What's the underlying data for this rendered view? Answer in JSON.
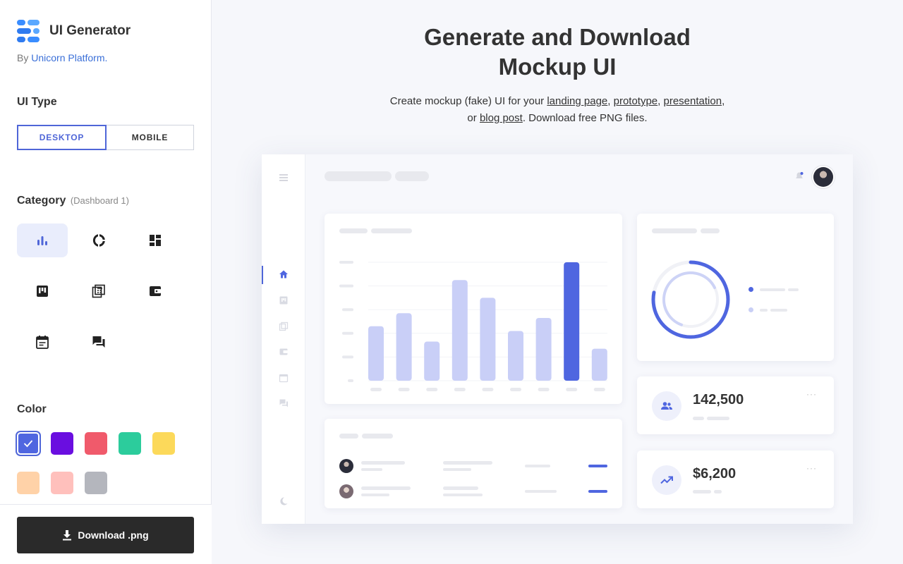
{
  "sidebar": {
    "app_title": "UI Generator",
    "byline_prefix": "By",
    "byline_link": "Unicorn Platform.",
    "ui_type": {
      "title": "UI Type",
      "options": [
        "DESKTOP",
        "MOBILE"
      ],
      "selected": "DESKTOP"
    },
    "category": {
      "title": "Category",
      "selected_label": "(Dashboard 1)",
      "icons": [
        "bar-chart-icon",
        "donut-chart-icon",
        "dashboard-grid-icon",
        "kanban-board-icon",
        "calculator-icon",
        "wallet-icon",
        "calendar-icon",
        "chat-bubbles-icon"
      ],
      "selected_index": 0
    },
    "color": {
      "title": "Color",
      "swatches": [
        "#4f66e0",
        "#6a0ee0",
        "#f05a6b",
        "#2ccc9c",
        "#fcd95a",
        "#ffd2a8",
        "#ffc0bc",
        "#b4b6bd"
      ],
      "selected_index": 0
    },
    "download_label": "Download .png"
  },
  "main": {
    "headline_line1": "Generate and Download",
    "headline_line2": "Mockup UI",
    "lede": {
      "t1": "Create mockup (fake) UI for your ",
      "l1": "landing page",
      "t2": ", ",
      "l2": "prototype",
      "t3": ", ",
      "l3": "presentation",
      "t4": ",",
      "t5": "or ",
      "l4": "blog post",
      "t6": ". Download free PNG files."
    }
  },
  "mockup": {
    "accent": "#4f66e0",
    "kpis": [
      {
        "value": "142,500",
        "icon": "users-icon"
      },
      {
        "value": "$6,200",
        "icon": "trend-up-icon"
      }
    ],
    "bar_chart": {
      "values": [
        0.46,
        0.57,
        0.33,
        0.85,
        0.7,
        0.42,
        0.53,
        1.0,
        0.27
      ],
      "highlight_index": 7
    },
    "donut": {
      "outer_fraction": 0.78,
      "inner_fraction": 0.62
    }
  }
}
